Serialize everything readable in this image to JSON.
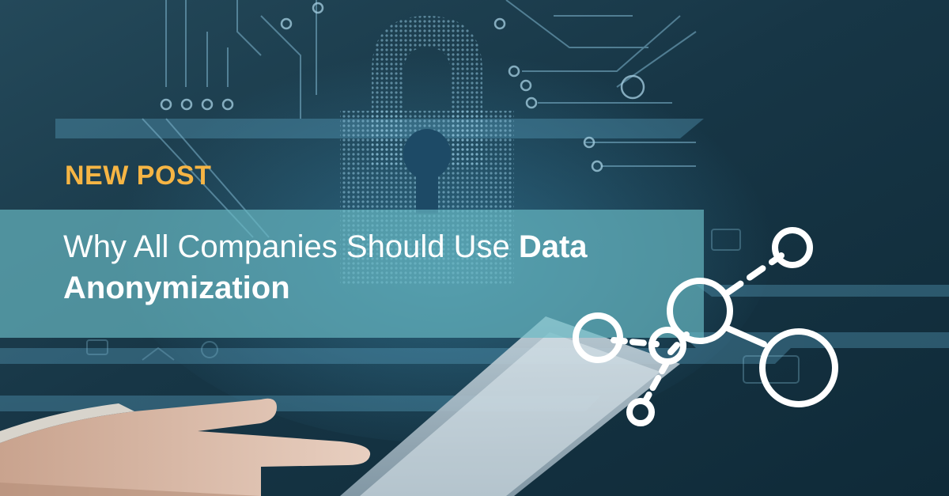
{
  "eyebrow": {
    "label": "NEW POST",
    "color": "#f6b544"
  },
  "headline": {
    "regular_part": "Why All Companies Should Use ",
    "bold_part_1": "Data",
    "bold_part_2": "Anonymization"
  },
  "graphics": {
    "background": "padlock-circuit-hand-tablet",
    "network_icon": "node-graph-icon"
  }
}
